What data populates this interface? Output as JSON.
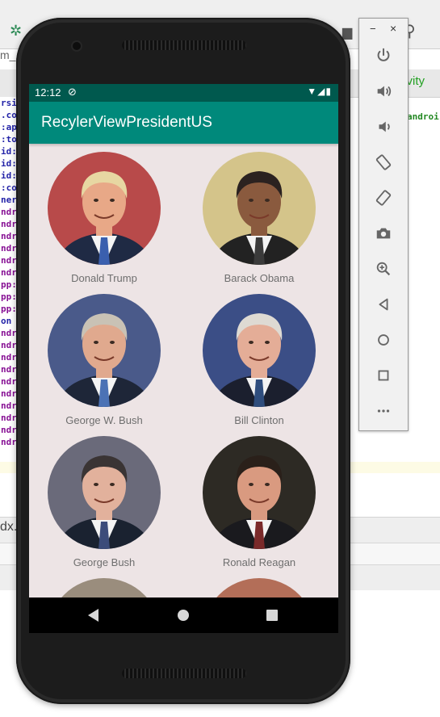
{
  "ide": {
    "left_tab_text": "m_",
    "code_lines": [
      "rsio",
      ".co",
      ":ap",
      ":to",
      "id:",
      "id:",
      "id:",
      ":co",
      "",
      "ner",
      "ndr",
      "ndr",
      "ndr",
      "ndr",
      "ndr",
      "ndr",
      "pp:",
      "pp:",
      "pp:",
      "",
      "on",
      "ndr",
      "ndr",
      "ndr",
      "ndr",
      "",
      "ndr",
      "ndr",
      "ndr",
      "ndr",
      "",
      "ndr",
      "ndr"
    ],
    "right_snippet": "tivity",
    "right_snippet2": "androi",
    "bottom_text": "dx."
  },
  "status_bar": {
    "time": "12:12",
    "sync_icon": "sync-disabled-icon",
    "icons": "wifi battery"
  },
  "app_bar": {
    "title": "RecylerViewPresidentUS"
  },
  "presidents": [
    {
      "name": "Donald Trump",
      "bg": "#b84a4a",
      "hair": "#e7d7a2",
      "skin": "#e8a887",
      "suit": "#1f2a44",
      "tie": "#3a5fae"
    },
    {
      "name": "Barack Obama",
      "bg": "#d4c48a",
      "hair": "#2b2220",
      "skin": "#8a5a3e",
      "suit": "#222222",
      "tie": "#3a3a3a"
    },
    {
      "name": "George W. Bush",
      "bg": "#4a5a8a",
      "hair": "#c9c2b5",
      "skin": "#e0a98e",
      "suit": "#1e2638",
      "tie": "#4b72b5"
    },
    {
      "name": "Bill Clinton",
      "bg": "#3b4e86",
      "hair": "#dedad3",
      "skin": "#e4ad97",
      "suit": "#1b1f2e",
      "tie": "#2f4d7d"
    },
    {
      "name": "George Bush",
      "bg": "#6a6a7a",
      "hair": "#3a3434",
      "skin": "#e2b19c",
      "suit": "#1a2230",
      "tie": "#3c4c7a"
    },
    {
      "name": "Ronald Reagan",
      "bg": "#2d2a24",
      "hair": "#2a201a",
      "skin": "#d99a80",
      "suit": "#1a1a1e",
      "tie": "#7a2a2a"
    },
    {
      "name": "",
      "bg": "#9a8d7d",
      "hair": "#d6cdb8",
      "skin": "#e3b6a2",
      "suit": "#2a2a2a",
      "tie": "#444444"
    },
    {
      "name": "",
      "bg": "#b36e58",
      "hair": "#bfb6ac",
      "skin": "#e2a58b",
      "suit": "#2a2a2a",
      "tie": "#444444"
    }
  ],
  "nav_bar": {
    "back": "back-icon",
    "home": "home-icon",
    "recents": "recents-icon"
  },
  "emulator_toolbar": {
    "minimize": "−",
    "close": "×",
    "buttons": [
      "power-icon",
      "volume-up-icon",
      "volume-down-icon",
      "rotate-left-icon",
      "rotate-right-icon",
      "camera-icon",
      "zoom-icon",
      "back-icon",
      "home-icon",
      "overview-icon",
      "more-icon"
    ]
  }
}
